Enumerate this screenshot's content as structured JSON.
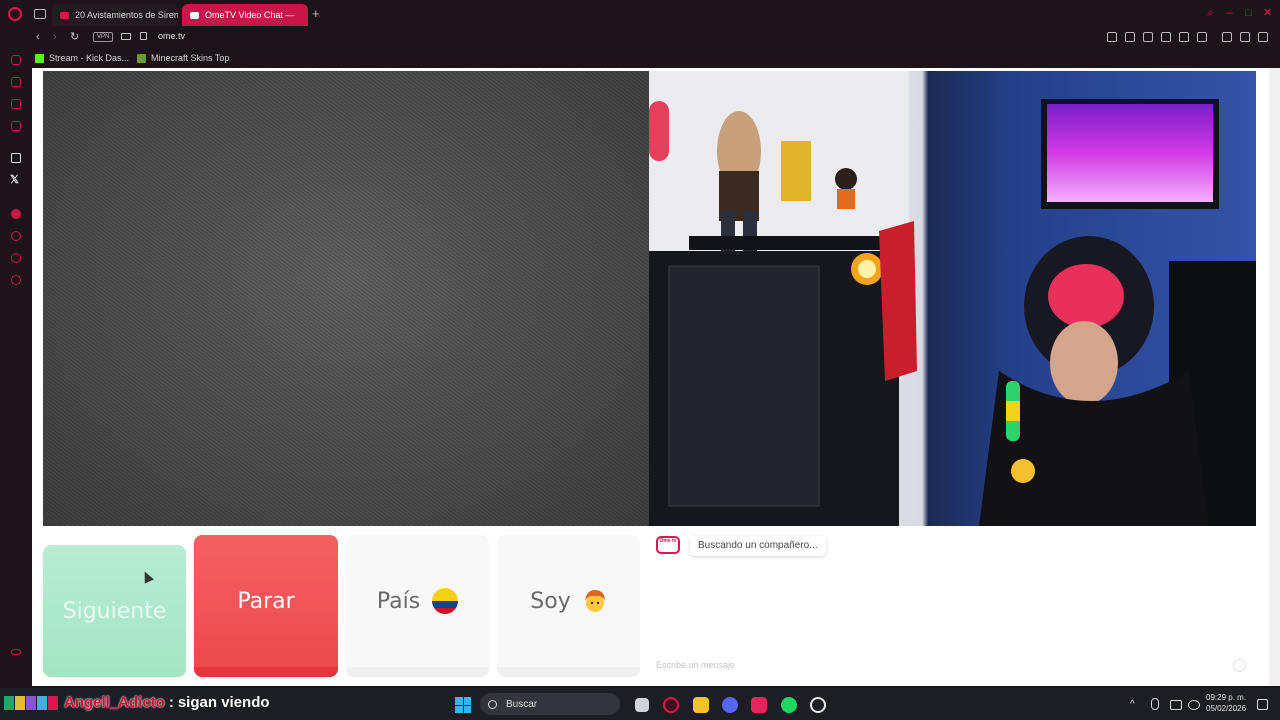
{
  "browser": {
    "tabs": [
      {
        "label": "20 Avistamientos de Siren..."
      },
      {
        "label": "OmeTV Video Chat —",
        "active": true
      }
    ],
    "new_tab": "+",
    "address": {
      "vpn_label": "VPN",
      "url": "ome.tv"
    },
    "bookmarks": [
      {
        "label": "Stream - Kick Das..."
      },
      {
        "label": "Minecraft Skins Top"
      }
    ],
    "controls": {
      "back": "‹",
      "forward": "›",
      "reload": "↻",
      "minimize": "–",
      "maximize": "□",
      "close": "✕",
      "search": "⌕"
    }
  },
  "sidebar": {
    "items": [
      "history-icon",
      "extensions-icon",
      "messenger-icon",
      "player-icon",
      "aria-icon",
      "x-icon",
      "music-icon",
      "clock-icon",
      "settings-icon"
    ],
    "x_label": "𝕏"
  },
  "ometv": {
    "buttons": {
      "next": "Siguiente",
      "stop": "Parar",
      "country": "País",
      "gender": "Soy"
    },
    "chat": {
      "logo_text": "Ome tv",
      "status_message": "Buscando un compañero...",
      "input_placeholder": "Escribe un mensaje"
    },
    "flag_colors": [
      "#f7d117",
      "#1b3f95",
      "#ce1126"
    ]
  },
  "stream_overlay": {
    "username": "Angell_Adicto",
    "separator": ":",
    "message": "sigan viendo"
  },
  "taskbar": {
    "search_placeholder": "Buscar",
    "time": "09:29 p. m.",
    "date": "05/02/2026"
  },
  "colors": {
    "accent": "#e0144c",
    "stop_button": "#ee4f53",
    "next_button": "#a8e7c7"
  }
}
